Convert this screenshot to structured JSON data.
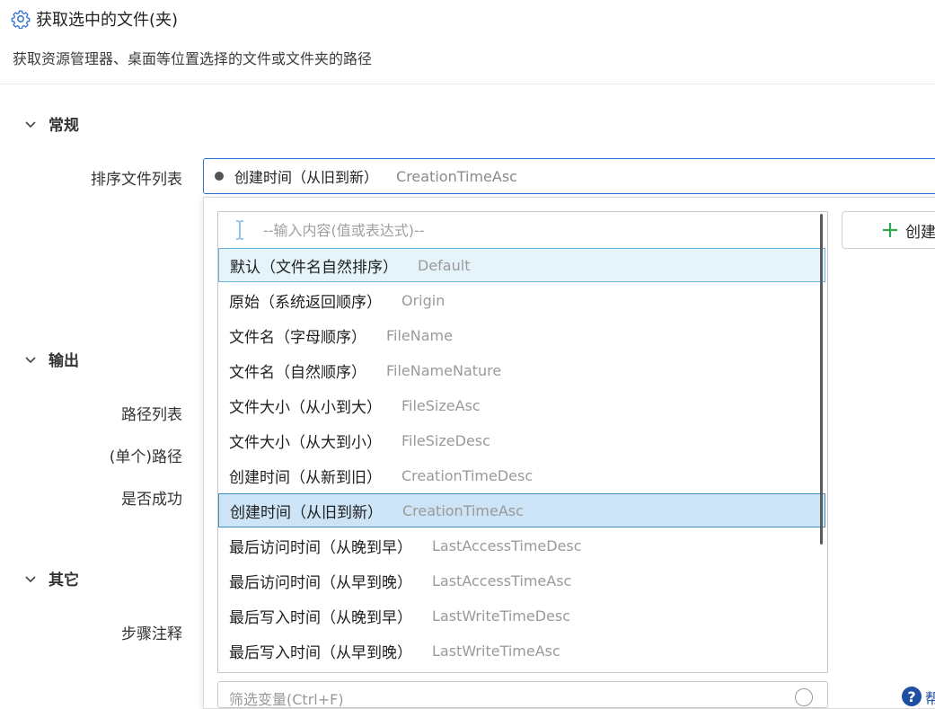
{
  "header": {
    "title": "获取选中的文件(夹)",
    "description": "获取资源管理器、桌面等位置选择的文件或文件夹的路径"
  },
  "sections": {
    "general": {
      "label": "常规"
    },
    "output": {
      "label": "输出"
    },
    "other": {
      "label": "其它"
    }
  },
  "fields": {
    "sort_list": "排序文件列表",
    "path_list": "路径列表",
    "single_path": "(单个)路径",
    "success": "是否成功",
    "step_note": "步骤注释"
  },
  "combo": {
    "selected_cn": "创建时间（从旧到新）",
    "selected_en": "CreationTimeAsc"
  },
  "dropdown": {
    "search_placeholder": "--输入内容(值或表达式)--",
    "options": [
      {
        "cn": "默认（文件名自然排序）",
        "en": "Default"
      },
      {
        "cn": "原始（系统返回顺序）",
        "en": "Origin"
      },
      {
        "cn": "文件名（字母顺序）",
        "en": "FileName"
      },
      {
        "cn": "文件名（自然顺序）",
        "en": "FileNameNature"
      },
      {
        "cn": "文件大小（从小到大）",
        "en": "FileSizeAsc"
      },
      {
        "cn": "文件大小（从大到小）",
        "en": "FileSizeDesc"
      },
      {
        "cn": "创建时间（从新到旧）",
        "en": "CreationTimeDesc"
      },
      {
        "cn": "创建时间（从旧到新）",
        "en": "CreationTimeAsc"
      },
      {
        "cn": "最后访问时间（从晚到早）",
        "en": "LastAccessTimeDesc"
      },
      {
        "cn": "最后访问时间（从早到晚）",
        "en": "LastAccessTimeAsc"
      },
      {
        "cn": "最后写入时间（从晚到早）",
        "en": "LastWriteTimeDesc"
      },
      {
        "cn": "最后写入时间（从早到晚）",
        "en": "LastWriteTimeAsc"
      }
    ],
    "create_button": "创建",
    "filter_placeholder": "筛选变量(Ctrl+F)"
  },
  "help": {
    "icon": "?",
    "label": "帮"
  },
  "colors": {
    "accent": "#2a6fd6",
    "hover_bg": "#e5f3fb",
    "selected_bg": "#cce4f5",
    "plus_green": "#2fa84f"
  },
  "icons": {
    "title": "gear-icon",
    "section": "chevron-down-icon",
    "create": "plus-icon",
    "search": "text-cursor-icon"
  }
}
